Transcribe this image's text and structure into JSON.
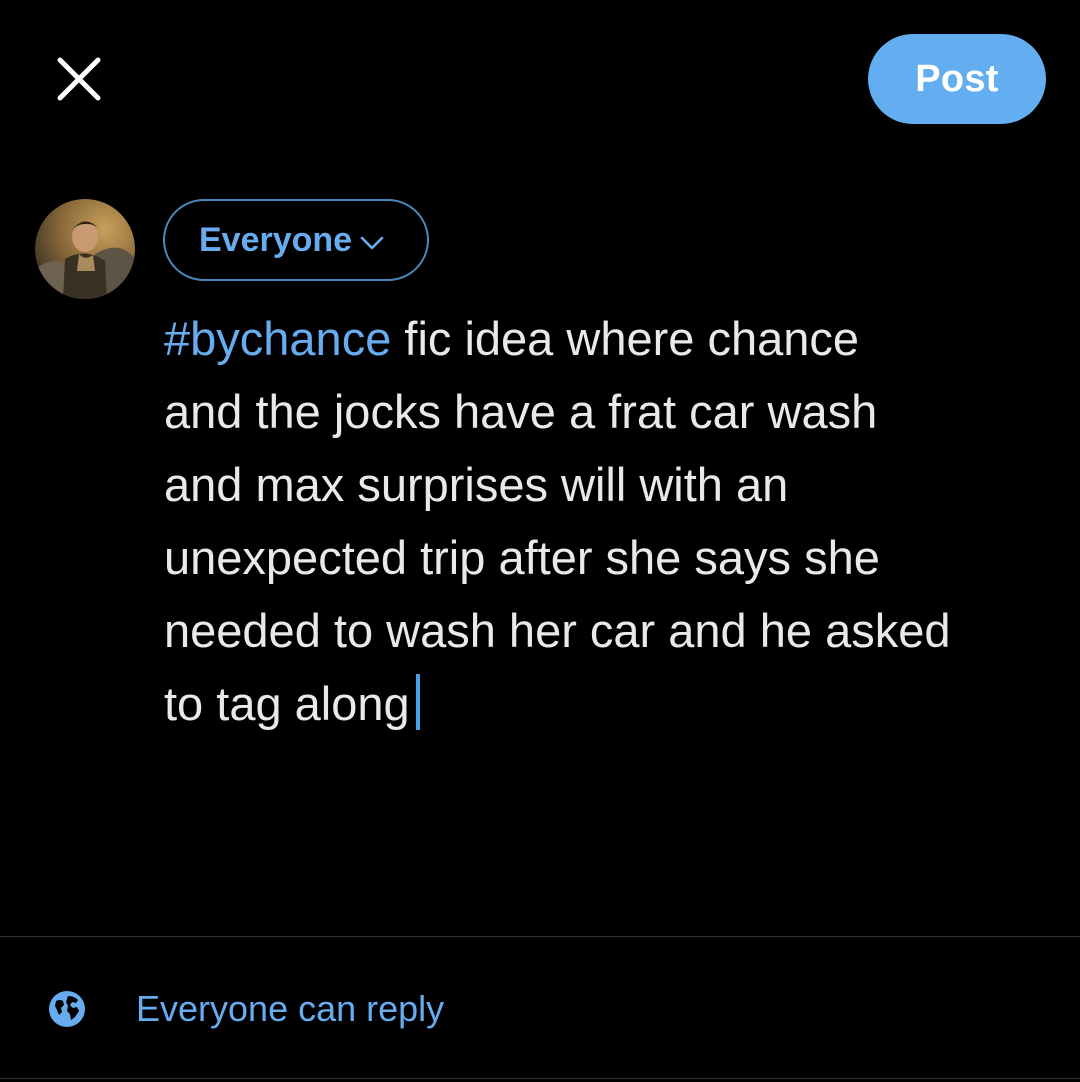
{
  "header": {
    "close_icon": "close-icon",
    "post_label": "Post"
  },
  "composer": {
    "avatar_icon": "user-avatar",
    "audience_label": "Everyone",
    "audience_icon": "chevron-down-icon",
    "hashtag": "#bychance",
    "text": " fic idea where chance\nand the jocks have a frat car wash\nand max surprises will with an\nunexpected trip after she says she\nneeded to wash her car and he asked\nto tag along"
  },
  "footer": {
    "reply_icon": "globe-icon",
    "reply_label": "Everyone can reply"
  },
  "colors": {
    "background": "#000000",
    "accent": "#62aef0",
    "link": "#68acf0",
    "text": "#e7e9ea",
    "divider": "#2f3336"
  }
}
